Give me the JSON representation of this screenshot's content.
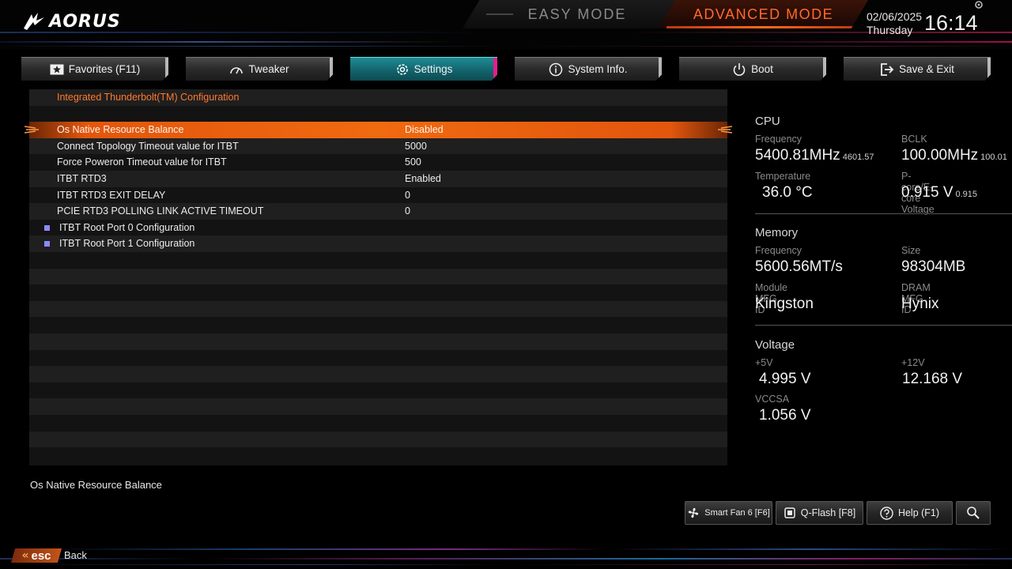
{
  "header": {
    "brand": "AORUS",
    "easy_mode": "EASY MODE",
    "advanced_mode": "ADVANCED MODE",
    "date": "02/06/2025",
    "weekday": "Thursday",
    "time": "16:14"
  },
  "tabs": [
    {
      "label": "Favorites (F11)",
      "icon": "star-icon"
    },
    {
      "label": "Tweaker",
      "icon": "gauge-icon"
    },
    {
      "label": "Settings",
      "icon": "gear-icon",
      "active": true
    },
    {
      "label": "System Info.",
      "icon": "info-icon"
    },
    {
      "label": "Boot",
      "icon": "power-icon"
    },
    {
      "label": "Save & Exit",
      "icon": "exit-icon"
    }
  ],
  "settings": {
    "header": "Integrated Thunderbolt(TM) Configuration",
    "rows": [
      {
        "label": "Os Native Resource Balance",
        "value": "Disabled",
        "selected": true
      },
      {
        "label": "Connect Topology Timeout value for ITBT",
        "value": "5000"
      },
      {
        "label": "Force Poweron Timeout value for ITBT",
        "value": "500"
      },
      {
        "label": "ITBT RTD3",
        "value": "Enabled"
      },
      {
        "label": "ITBT RTD3 EXIT DELAY",
        "value": "0"
      },
      {
        "label": "PCIE RTD3 POLLING LINK ACTIVE TIMEOUT",
        "value": "0"
      }
    ],
    "submenus": [
      {
        "label": "ITBT Root Port 0 Configuration"
      },
      {
        "label": "ITBT Root Port 1 Configuration"
      }
    ]
  },
  "help_text": "Os Native Resource Balance",
  "monitor": {
    "cpu": {
      "title": "CPU",
      "freq_label": "Frequency",
      "freq_value": "5400.81MHz",
      "freq_sub": "4601.57",
      "bclk_label": "BCLK",
      "bclk_value": "100.00MHz",
      "bclk_sub": "100.01",
      "temp_label": "Temperature",
      "temp_value": "36.0 °C",
      "volt_label": "P-core/E-core Voltage",
      "volt_value": "0.915 V",
      "volt_sub": "0.915"
    },
    "memory": {
      "title": "Memory",
      "freq_label": "Frequency",
      "freq_value": "5600.56MT/s",
      "size_label": "Size",
      "size_value": "98304MB",
      "module_label": "Module MFG ID",
      "module_value": "Kingston",
      "dram_label": "DRAM MFG ID",
      "dram_value": "Hynix"
    },
    "voltage": {
      "title": "Voltage",
      "v5_label": "+5V",
      "v5_value": "4.995 V",
      "v12_label": "+12V",
      "v12_value": "12.168 V",
      "vccsa_label": "VCCSA",
      "vccsa_value": "1.056 V"
    }
  },
  "bottom_buttons": {
    "smart_fan": "Smart Fan 6 [F6]",
    "qflash": "Q-Flash [F8]",
    "help": "Help (F1)"
  },
  "esc": {
    "key": "esc",
    "label": "Back"
  },
  "colors": {
    "accent": "#ff6a1a",
    "active_tab": "#1f8b95",
    "active_tab_edge": "#e0208f",
    "section_header": "#ff7a2a"
  }
}
